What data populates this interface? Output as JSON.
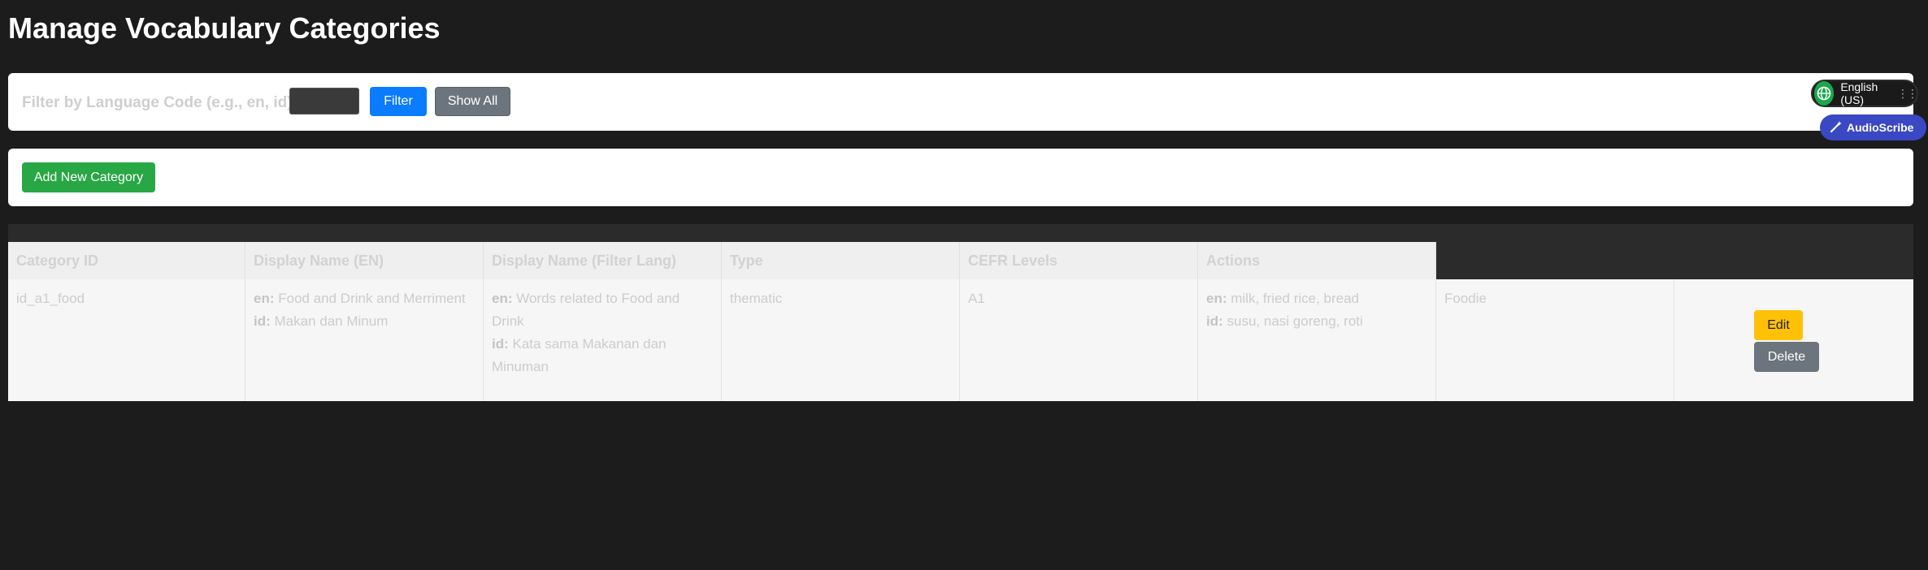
{
  "page": {
    "title": "Manage Vocabulary Categories"
  },
  "filter": {
    "label": "Filter by Language Code (e.g., en, id):",
    "input_value": "",
    "filter_button": "Filter",
    "show_all_button": "Show All"
  },
  "actions": {
    "add_button": "Add New Category"
  },
  "table": {
    "headers": [
      "Category ID",
      "Display Name (EN)",
      "Display Name (Filter Lang)",
      "Type",
      "CEFR Levels",
      "Actions"
    ],
    "rows": [
      {
        "category_id": "id_a1_food",
        "display_name_en": [
          {
            "lang": "en:",
            "text": "Food and Drink and Merriment"
          },
          {
            "lang": "id:",
            "text": "Makan dan Minum"
          }
        ],
        "display_name_filter": [
          {
            "lang": "en:",
            "text": "Words related to Food and Drink"
          },
          {
            "lang": "id:",
            "text": "Kata sama Makanan dan Minuman"
          }
        ],
        "type": "thematic",
        "cefr": "A1",
        "examples": [
          {
            "lang": "en:",
            "text": "milk, fried rice, bread"
          },
          {
            "lang": "id:",
            "text": "susu, nasi goreng, roti"
          }
        ],
        "tag": "Foodie",
        "edit_label": "Edit",
        "delete_label": "Delete"
      }
    ]
  },
  "extensions": {
    "language_widget": "English (US)",
    "audioscribe": "AudioScribe"
  },
  "colors": {
    "background": "#1c1c1c",
    "primary": "#0b7bff",
    "success": "#28a745",
    "warning": "#ffc107",
    "secondary": "#6c757d",
    "audioscribe": "#3b48c4"
  }
}
